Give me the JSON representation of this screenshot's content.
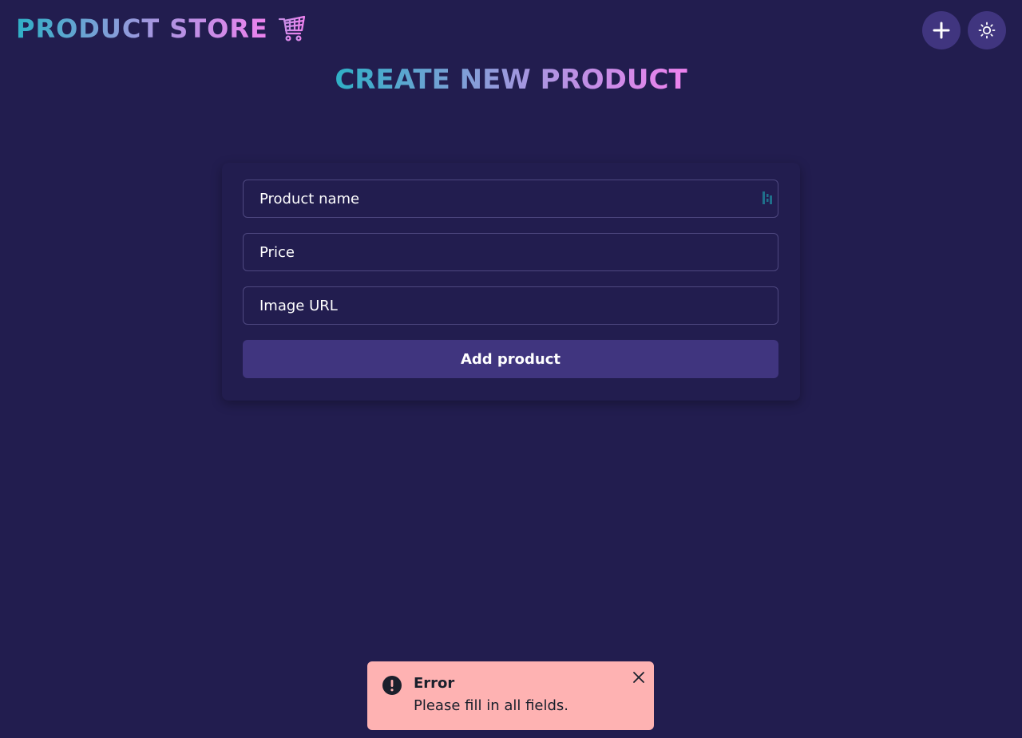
{
  "navbar": {
    "brand": "PRODUCT STORE",
    "brand_icon": "shopping-cart-icon",
    "add_button_icon": "plus-icon",
    "theme_button_icon": "sun-icon"
  },
  "page": {
    "title": "CREATE NEW PRODUCT"
  },
  "form": {
    "name_placeholder": "Product name",
    "price_placeholder": "Price",
    "image_placeholder": "Image URL",
    "submit_label": "Add product"
  },
  "toast": {
    "title": "Error",
    "description": "Please fill in all fields.",
    "icon": "alert-circle-icon",
    "close_icon": "close-icon"
  },
  "colors": {
    "background": "#221d4f",
    "button": "#40357f",
    "gradient_start": "#2fb0c6",
    "gradient_end": "#ee82ee",
    "toast_bg": "#feb2b2"
  }
}
